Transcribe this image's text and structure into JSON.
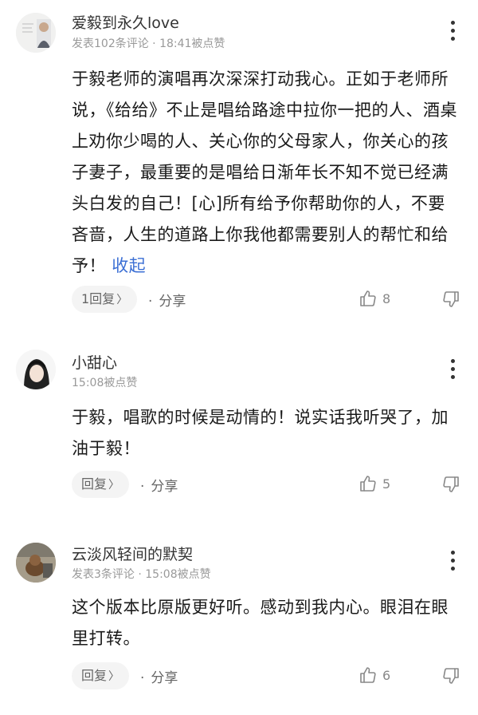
{
  "comments": [
    {
      "username": "爱毅到永久love",
      "meta": "发表102条评论 · 18:41被点赞",
      "body": "于毅老师的演唱再次深深打动我心。正如于老师所说，《给给》不止是唱给路途中拉你一把的人、酒桌上劝你少喝的人、关心你的父母家人，你关心的孩子妻子，最重要的是唱给日渐年长不知不觉已经满头白发的自己！[心]所有给予你帮助你的人，不要吝啬，人生的道路上你我他都需要别人的帮忙和给予！",
      "collapse": "收起",
      "reply_label": "1回复",
      "share_label": "分享",
      "likes": "8"
    },
    {
      "username": "小甜心",
      "meta": "15:08被点赞",
      "body": "于毅，唱歌的时候是动情的！说实话我听哭了，加油于毅！",
      "reply_label": "回复",
      "share_label": "分享",
      "likes": "5"
    },
    {
      "username": "云淡风轻间的默契",
      "meta": "发表3条评论 · 15:08被点赞",
      "body": "这个版本比原版更好听。感动到我内心。眼泪在眼里打转。",
      "reply_label": "回复",
      "share_label": "分享",
      "likes": "6"
    }
  ],
  "icons": {
    "more": "more-vertical-icon",
    "like": "thumbs-up-icon",
    "dislike": "thumbs-down-icon",
    "chevron": "chevron-right-icon"
  },
  "colors": {
    "link": "#3b6fd4",
    "meta": "#999999",
    "text": "#1a1a1a"
  }
}
